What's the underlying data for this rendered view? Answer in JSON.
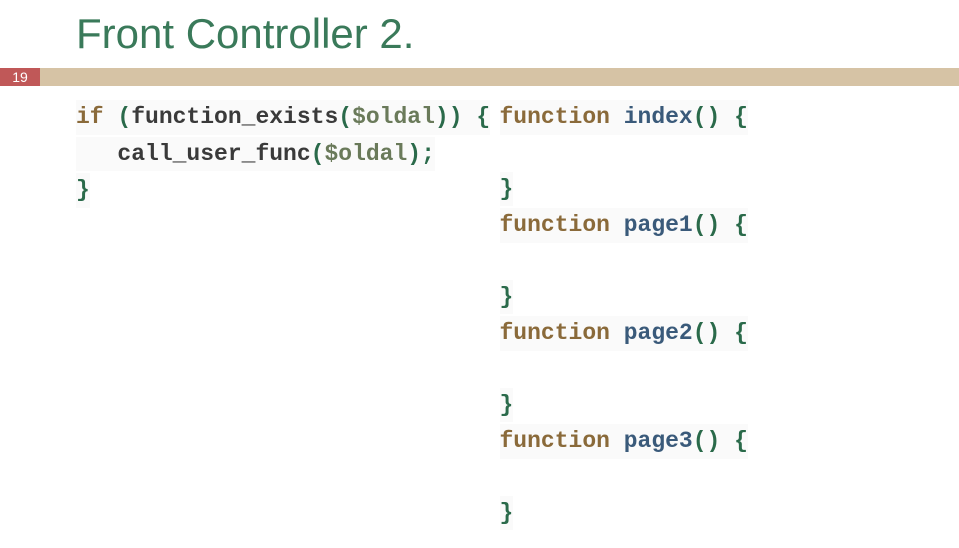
{
  "title": "Front Controller 2.",
  "page_number": "19",
  "left_col": {
    "line1": {
      "if": "if",
      "open_paren": " (",
      "func": "function_exists",
      "args_open": "(",
      "var": "$oldal",
      "args_close": ")",
      "close_paren": ") ",
      "brace": "{"
    },
    "line2": {
      "indent": "   ",
      "func": "call_user_func",
      "args_open": "(",
      "var": "$oldal",
      "args_close": ");"
    },
    "line3": "}"
  },
  "right_col": {
    "block1": {
      "kw": "function",
      "name": " index",
      "parens": "() ",
      "open": "{"
    },
    "block2": {
      "kw": "function",
      "name": " page1",
      "parens": "() ",
      "open": "{"
    },
    "block3": {
      "kw": "function",
      "name": " page2",
      "parens": "() ",
      "open": "{"
    },
    "block4": {
      "kw": "function",
      "name": " page3",
      "parens": "() ",
      "open": "{"
    },
    "close": "}"
  }
}
